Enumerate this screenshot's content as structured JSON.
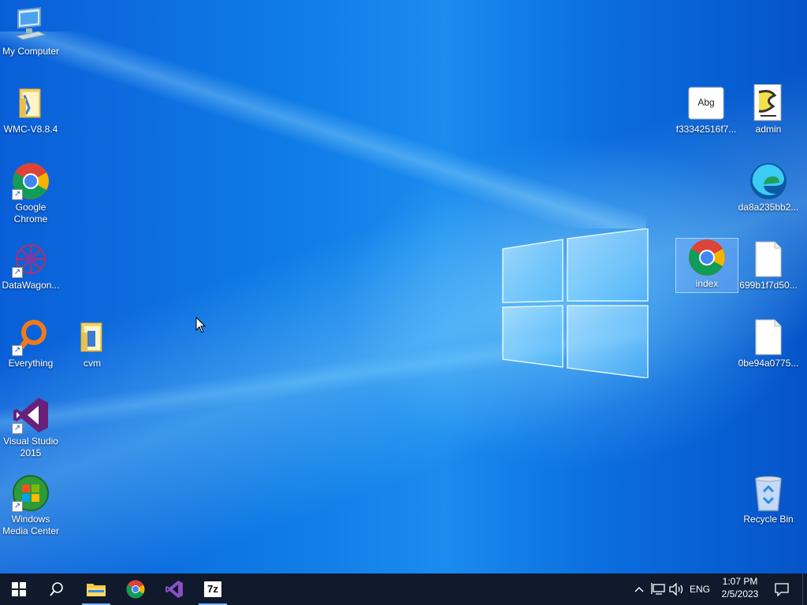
{
  "desktop": {
    "left_icons": [
      {
        "id": "my-computer",
        "label": "My Computer",
        "icon": "monitor-icon"
      },
      {
        "id": "wmc",
        "label": "WMC-V8.8.4",
        "icon": "folder-icon"
      },
      {
        "id": "chrome",
        "label": "Google Chrome",
        "icon": "chrome-icon"
      },
      {
        "id": "datawagon",
        "label": "DataWagon...",
        "icon": "datawagon-icon"
      },
      {
        "id": "everything",
        "label": "Everything",
        "icon": "magnifier-icon"
      },
      {
        "id": "cvm",
        "label": "cvm",
        "icon": "folder-icon"
      },
      {
        "id": "vs2015",
        "label": "Visual Studio 2015",
        "icon": "visual-studio-icon"
      },
      {
        "id": "wmcenter",
        "label": "Windows Media Center",
        "icon": "windows-media-center-icon"
      }
    ],
    "right_icons": [
      {
        "id": "font-file",
        "label": "f33342516f7...",
        "icon": "font-file-icon",
        "glyph": "Abg"
      },
      {
        "id": "admin",
        "label": "admin",
        "icon": "script-file-icon"
      },
      {
        "id": "edge",
        "label": "da8a235bb2...",
        "icon": "edge-icon"
      },
      {
        "id": "index",
        "label": "index",
        "icon": "chrome-icon",
        "selected": true
      },
      {
        "id": "file1",
        "label": "699b1f7d50...",
        "icon": "blank-file-icon"
      },
      {
        "id": "file2",
        "label": "0be94a0775...",
        "icon": "blank-file-icon"
      },
      {
        "id": "recycle",
        "label": "Recycle Bin",
        "icon": "recycle-bin-icon"
      }
    ]
  },
  "taskbar": {
    "start_icon": "windows-logo-icon",
    "search_icon": "search-icon",
    "pinned": [
      {
        "name": "file-explorer",
        "icon": "folder-icon",
        "active": true
      },
      {
        "name": "google-chrome",
        "icon": "chrome-icon",
        "active": false
      },
      {
        "name": "visual-studio",
        "icon": "visual-studio-icon",
        "active": false
      },
      {
        "name": "7zip",
        "icon": "7zip-icon",
        "label": "7z",
        "active": true
      }
    ],
    "tray": {
      "language": "ENG",
      "time": "1:07 PM",
      "date": "2/5/2023"
    }
  },
  "colors": {
    "taskbar": "#101a2c",
    "desktop_blue": "#0f7be6",
    "accent": "#7ab4ff"
  }
}
